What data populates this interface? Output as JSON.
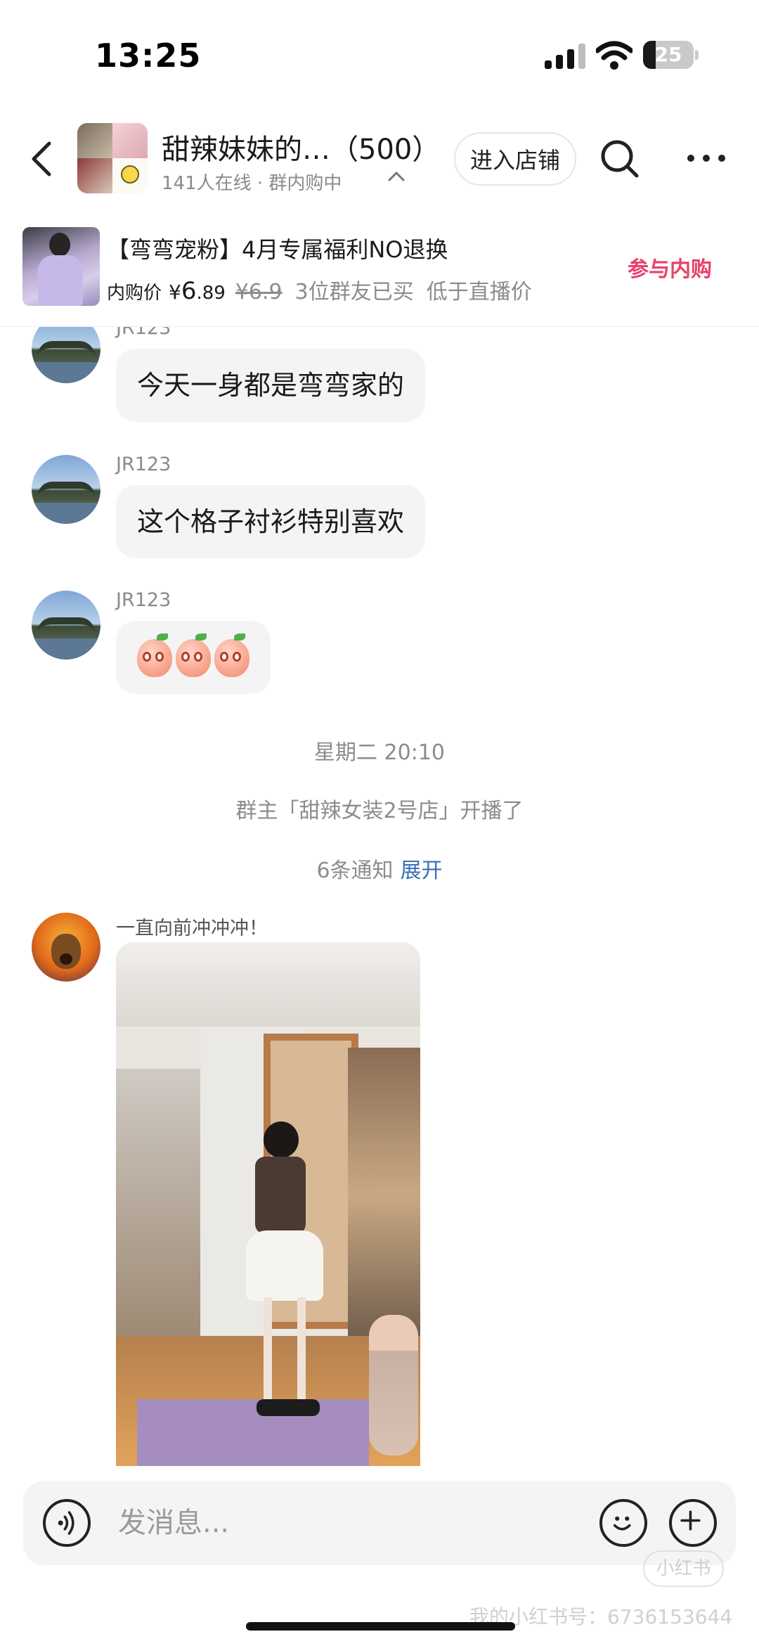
{
  "status_bar": {
    "time": "13:25",
    "battery_level": "25",
    "battery_fraction": 0.25
  },
  "header": {
    "title": "甜辣妹妹的…（500）",
    "subtitle": "141人在线 · 群内购中",
    "shop_button": "进入店铺"
  },
  "product": {
    "title": "【弯弯宠粉】4月专属福利NO退换",
    "price_label": "内购价",
    "currency": "¥",
    "price_int": "6",
    "price_dec": ".89",
    "original_price": "¥6.9",
    "buyers": "3位群友已买",
    "compare": "低于直播价",
    "join_button": "参与内购",
    "accent_color": "#e8416a"
  },
  "messages": [
    {
      "name": "JR123",
      "text": "今天一身都是弯弯家的"
    },
    {
      "name": "JR123",
      "text": "这个格子衬衫特别喜欢"
    },
    {
      "name": "JR123",
      "emoji_count": 3
    }
  ],
  "system": {
    "time": "星期二 20:10",
    "live_notice": "群主「甜辣女装2号店」开播了",
    "notice_count": "6条通知",
    "expand": "展开",
    "link_color": "#3a6fb5"
  },
  "video_message": {
    "caption": "一直向前冲冲冲！"
  },
  "input": {
    "placeholder": "发消息..."
  },
  "watermark": {
    "logo": "小红书",
    "text": "我的小红书号：6736153644"
  }
}
